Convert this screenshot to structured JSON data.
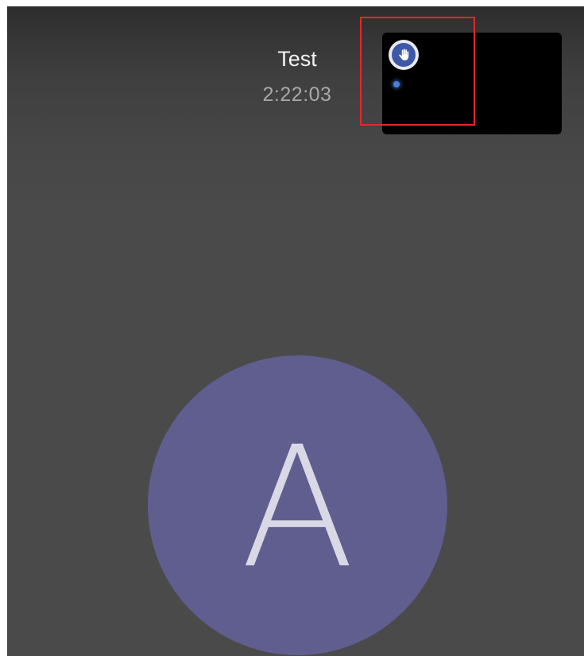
{
  "call": {
    "title": "Test",
    "timer": "2:22:03"
  },
  "self_preview": {
    "badge_icon": "raised-hand-icon",
    "status_dot_color": "#4a7fd6"
  },
  "participant": {
    "initial": "A",
    "avatar_color": "#5f5e8f"
  },
  "annotation": {
    "highlight_color": "#e8262a"
  }
}
